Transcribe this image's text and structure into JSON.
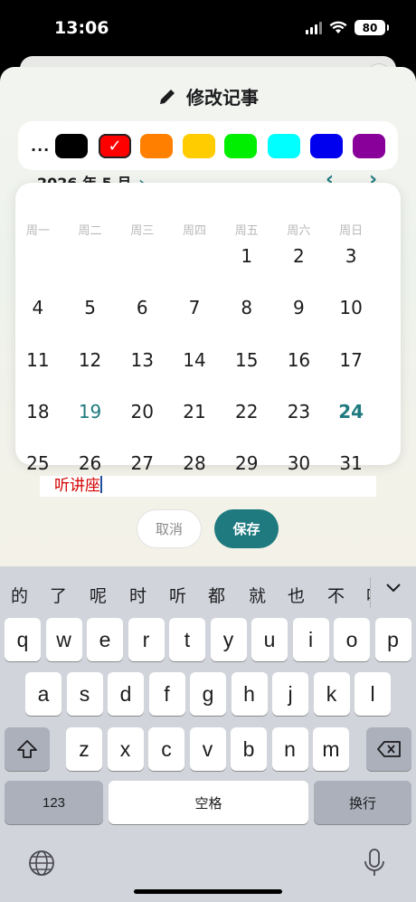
{
  "status": {
    "time": "13:06",
    "battery": "80"
  },
  "editor": {
    "title": "修改记事",
    "more_label": "...",
    "colors": [
      {
        "name": "black",
        "hex": "#000000",
        "selected": false
      },
      {
        "name": "red",
        "hex": "#ff0000",
        "selected": true
      },
      {
        "name": "orange",
        "hex": "#ff7f00",
        "selected": false
      },
      {
        "name": "yellow",
        "hex": "#ffcc00",
        "selected": false
      },
      {
        "name": "green",
        "hex": "#00ee00",
        "selected": false
      },
      {
        "name": "cyan",
        "hex": "#00ffff",
        "selected": false
      },
      {
        "name": "blue",
        "hex": "#0000ee",
        "selected": false
      },
      {
        "name": "purple",
        "hex": "#880099",
        "selected": false
      }
    ],
    "month_label": "2026 年 5 月",
    "weekdays": [
      "周一",
      "周二",
      "周三",
      "周四",
      "周五",
      "周六",
      "周日"
    ],
    "weeks": [
      [
        "",
        "",
        "",
        "",
        "1",
        "2",
        "3"
      ],
      [
        "4",
        "5",
        "6",
        "7",
        "8",
        "9",
        "10"
      ],
      [
        "11",
        "12",
        "13",
        "14",
        "15",
        "16",
        "17"
      ],
      [
        "18",
        "19",
        "20",
        "21",
        "22",
        "23",
        "24"
      ],
      [
        "25",
        "26",
        "27",
        "28",
        "29",
        "30",
        "31"
      ]
    ],
    "today": "19",
    "selected_day": "24",
    "note_text": "听讲座",
    "cancel_label": "取消",
    "save_label": "保存",
    "accent_color": "#1f7a7f"
  },
  "keyboard": {
    "candidates": [
      "的",
      "了",
      "呢",
      "时",
      "听",
      "都",
      "就",
      "也",
      "不",
      "吗"
    ],
    "row1": [
      "q",
      "w",
      "e",
      "r",
      "t",
      "y",
      "u",
      "i",
      "o",
      "p"
    ],
    "row2": [
      "a",
      "s",
      "d",
      "f",
      "g",
      "h",
      "j",
      "k",
      "l"
    ],
    "row3": [
      "z",
      "x",
      "c",
      "v",
      "b",
      "n",
      "m"
    ],
    "numbers_label": "123",
    "space_label": "空格",
    "return_label": "换行"
  }
}
